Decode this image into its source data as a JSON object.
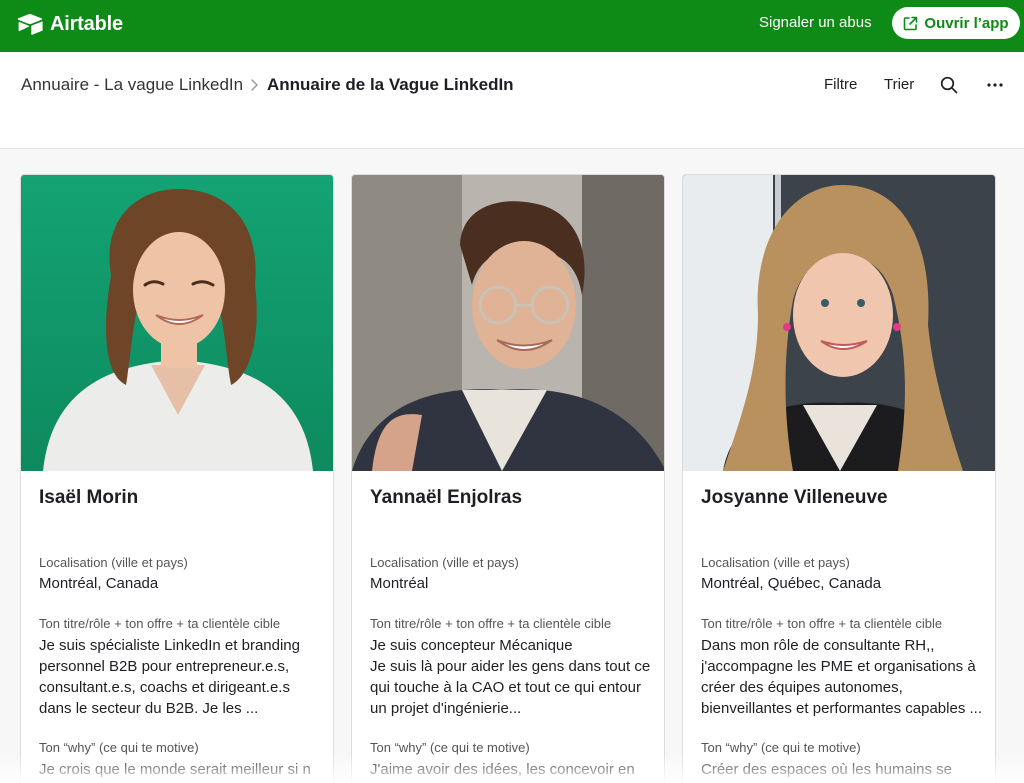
{
  "header": {
    "brand": "Airtable",
    "report_label": "Signaler un abus",
    "open_app_label": "Ouvrir l’app"
  },
  "subheader": {
    "breadcrumb_parent": "Annuaire - La vague LinkedIn",
    "breadcrumb_current": "Annuaire de la Vague LinkedIn",
    "filter_label": "Filtre",
    "sort_label": "Trier"
  },
  "field_labels": {
    "location": "Localisation (ville et pays)",
    "title": "Ton titre/rôle + ton offre + ta clientèle cible",
    "why": "Ton “why” (ce qui te motive)"
  },
  "cards": [
    {
      "name": "Isaël Morin",
      "location": "Montréal, Canada",
      "title": "Je suis spécialiste LinkedIn et branding personnel B2B pour entrepreneur.e.s, consultant.e.s, coachs et dirigeant.e.s dans le secteur du B2B. Je les ...",
      "why": "Je crois que le monde serait meilleur si n"
    },
    {
      "name": "Yannaël Enjolras",
      "location": "Montréal",
      "title": "Je suis concepteur Mécanique\nJe suis là pour aider les gens dans tout ce qui touche à la CAO et tout ce qui entour un projet d'ingénierie...",
      "why": "J'aime avoir des idées, les concevoir en"
    },
    {
      "name": "Josyanne Villeneuve",
      "location": "Montréal, Québec, Canada",
      "title": "Dans mon rôle de consultante RH,, j'accompagne les PME et organisations à créer des équipes autonomes, bienveillantes et performantes capables ...",
      "why": "Créer des espaces où les humains se"
    }
  ],
  "colors": {
    "brand_green": "#0e8a16",
    "photo1_bg": "#14a374"
  }
}
